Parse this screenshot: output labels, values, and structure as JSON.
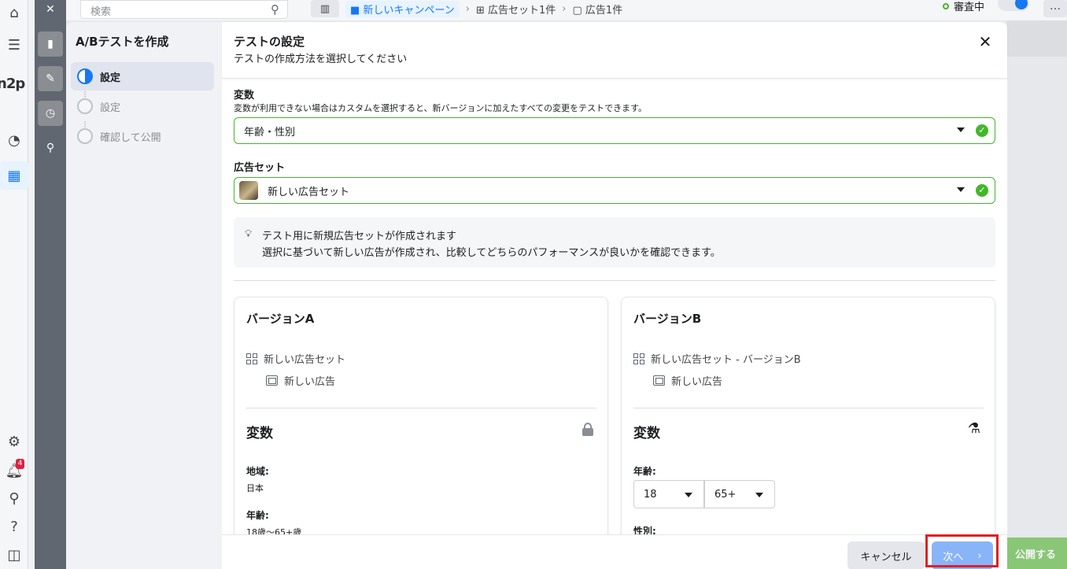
{
  "leftnav": {
    "logo": "n2p",
    "notification_count": "4"
  },
  "topbar": {
    "search_placeholder": "検索",
    "breadcrumbs": [
      "新しいキャンペーン",
      "広告セット1件",
      "広告1件"
    ],
    "status": "審査中",
    "publish": "公開する"
  },
  "steps": {
    "title": "A/Bテストを作成",
    "items": [
      {
        "label": "設定"
      },
      {
        "label": "設定"
      },
      {
        "label": "確認して公開"
      }
    ]
  },
  "dialog": {
    "title": "テストの設定",
    "subtitle": "テストの作成方法を選択してください",
    "variable_label": "変数",
    "variable_help": "変数が利用できない場合はカスタムを選択すると、新バージョンに加えたすべての変更をテストできます。",
    "variable_value": "年齢・性別",
    "adset_label": "広告セット",
    "adset_value": "新しい広告セット",
    "info_line1": "テスト用に新規広告セットが作成されます",
    "info_line2": "選択に基づいて新しい広告が作成され、比較してどちらのパフォーマンスが良いかを確認できます。",
    "version_a": {
      "title": "バージョンA",
      "adset": "新しい広告セット",
      "ad": "新しい広告",
      "variables_title": "変数",
      "region_key": "地域:",
      "region_value": "日本",
      "age_key": "年齢:",
      "age_value": "18歳〜65+歳"
    },
    "version_b": {
      "title": "バージョンB",
      "adset": "新しい広告セット - バージョンB",
      "ad": "新しい広告",
      "variables_title": "変数",
      "age_key": "年齢:",
      "age_min": "18",
      "age_max": "65+",
      "gender_key": "性別:"
    },
    "cancel": "キャンセル",
    "next": "次へ"
  }
}
